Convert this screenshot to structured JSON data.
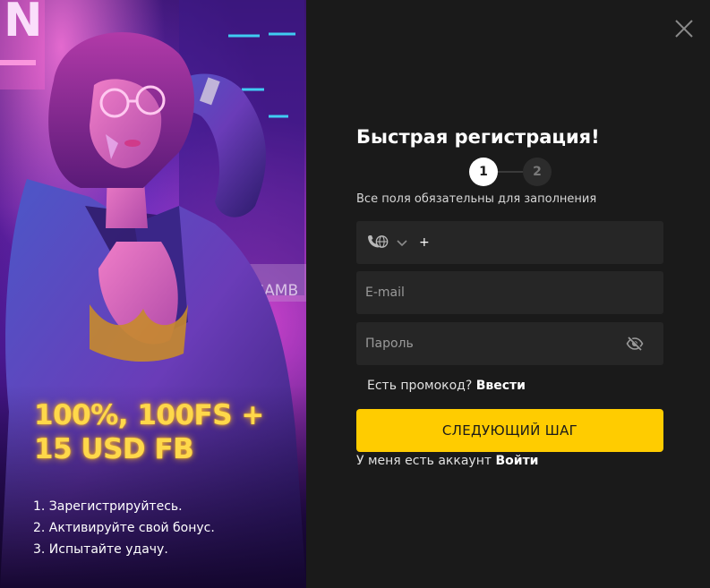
{
  "promo": {
    "headline": "100%, 100FS + 15 USD FB",
    "steps": [
      "1. Зарегистрируйтесь.",
      "2. Активируйте свой бонус.",
      "3. Испытайте удачу."
    ],
    "sign_text": "GAMB",
    "neon_letter": "N",
    "accent_color": "#ffd84a"
  },
  "modal": {
    "close_icon": "close-icon",
    "title": "Быстрая регистрация!",
    "steps": [
      "1",
      "2"
    ],
    "active_step": "1",
    "subtitle": "Все поля обязательны для заполнения",
    "phone": {
      "icon": "phone-globe-icon",
      "prefix": "+",
      "value": ""
    },
    "email": {
      "placeholder": "E-mail",
      "value": ""
    },
    "password": {
      "placeholder": "Пароль",
      "value": "",
      "toggle_icon": "eye-off-icon"
    },
    "promo_question": "Есть промокод?",
    "promo_link": "Ввести",
    "next_button": "СЛЕДУЮЩИЙ ШАГ",
    "login_question": "У меня есть аккаунт",
    "login_link": "Войти",
    "button_color": "#ffcc00",
    "background_color": "#1a1a1a"
  }
}
